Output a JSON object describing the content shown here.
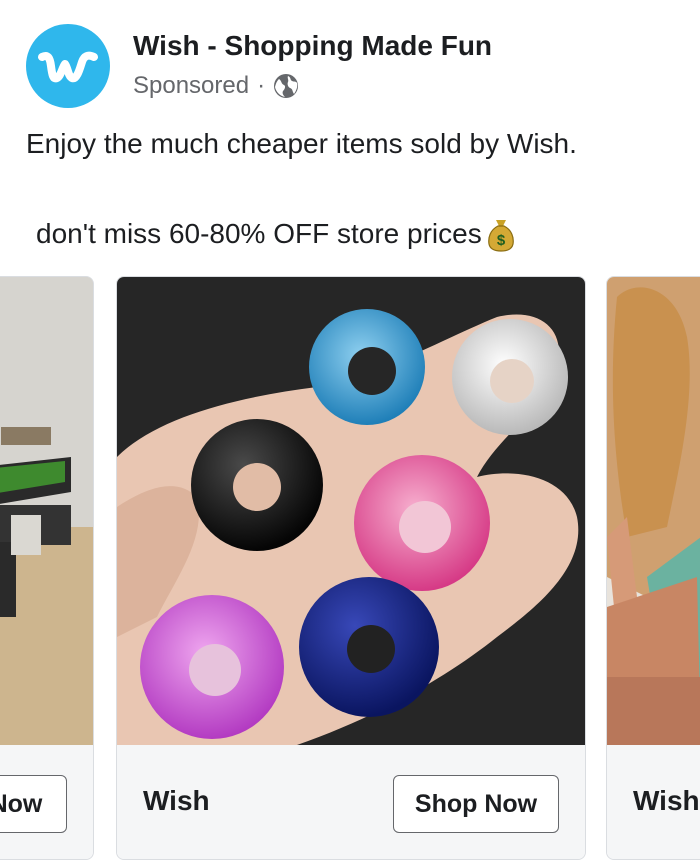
{
  "post": {
    "page_name": "Wish - Shopping Made Fun",
    "sponsored_label": "Sponsored",
    "separator": "·",
    "text_line1": "Enjoy the much cheaper items sold by Wish.",
    "text_line2": "don't miss 60-80% OFF store prices"
  },
  "carousel": {
    "cards": [
      {
        "title": "",
        "cta": "Now"
      },
      {
        "title": "Wish",
        "cta": "Shop Now"
      },
      {
        "title": "Wish",
        "cta": ""
      }
    ]
  },
  "colors": {
    "brand": "#2fb7ec",
    "footer_bg": "#f5f6f7",
    "secondary_text": "#65676b"
  },
  "icons": [
    "wish-logo-icon",
    "globe-icon",
    "money-bag-icon"
  ]
}
